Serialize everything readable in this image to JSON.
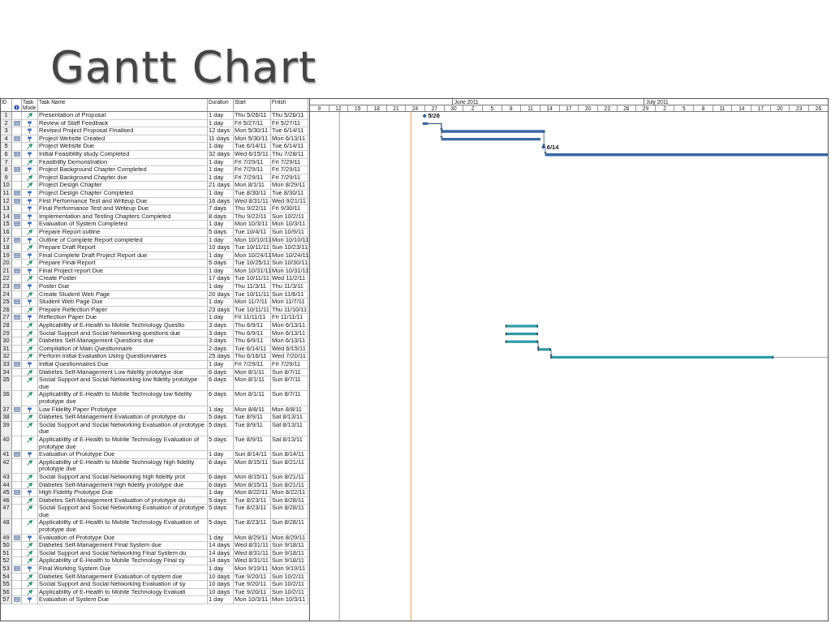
{
  "slide": {
    "title": "Gantt Chart"
  },
  "table": {
    "columns": [
      "ID",
      "Task Mode",
      "Task Name",
      "Duration",
      "Start",
      "Finish"
    ],
    "rows": [
      {
        "id": "1",
        "indicator": false,
        "kind": "auto",
        "name": "Presentation of Proposal",
        "duration": "1 day",
        "start": "Thu 5/26/11",
        "finish": "Thu 5/26/11"
      },
      {
        "id": "2",
        "indicator": true,
        "kind": "manual",
        "name": "Review of Staff Feedback",
        "duration": "1 day",
        "start": "Fri 5/27/11",
        "finish": "Fri 5/27/11"
      },
      {
        "id": "3",
        "indicator": false,
        "kind": "manual",
        "name": "Revised Project Proposal Finalised",
        "duration": "12 days",
        "start": "Mon 5/30/11",
        "finish": "Tue 6/14/11"
      },
      {
        "id": "4",
        "indicator": true,
        "kind": "manual",
        "name": "Project Website Created",
        "duration": "11 days",
        "start": "Mon 5/30/11",
        "finish": "Mon 6/13/11"
      },
      {
        "id": "5",
        "indicator": false,
        "kind": "auto",
        "name": "Project Website Due",
        "duration": "1 day",
        "start": "Tue 6/14/11",
        "finish": "Tue 6/14/11"
      },
      {
        "id": "6",
        "indicator": true,
        "kind": "manual",
        "name": "Initial Feasibility study Completed",
        "duration": "32 days",
        "start": "Wed 6/15/11",
        "finish": "Thu 7/28/11"
      },
      {
        "id": "7",
        "indicator": false,
        "kind": "auto",
        "name": "Feasibility Demonstration",
        "duration": "1 day",
        "start": "Fri 7/29/11",
        "finish": "Fri 7/29/11"
      },
      {
        "id": "8",
        "indicator": true,
        "kind": "manual",
        "name": "Project Background Chapter Completed",
        "duration": "1 day",
        "start": "Fri 7/29/11",
        "finish": "Fri 7/29/11"
      },
      {
        "id": "9",
        "indicator": false,
        "kind": "auto",
        "name": "Project Background Chapter due",
        "duration": "1 day",
        "start": "Fri 7/29/11",
        "finish": "Fri 7/29/11"
      },
      {
        "id": "10",
        "indicator": false,
        "kind": "auto",
        "name": "Project Design Chapter",
        "duration": "21 days",
        "start": "Mon 8/1/11",
        "finish": "Mon 8/29/11"
      },
      {
        "id": "11",
        "indicator": true,
        "kind": "manual",
        "name": "Project Design Chapter Completed",
        "duration": "1 day",
        "start": "Tue 8/30/11",
        "finish": "Tue 8/30/11"
      },
      {
        "id": "12",
        "indicator": true,
        "kind": "manual",
        "name": "First Performance Test and Writeup Due",
        "duration": "16 days",
        "start": "Wed 8/31/11",
        "finish": "Wed 9/21/11"
      },
      {
        "id": "13",
        "indicator": false,
        "kind": "manual",
        "name": "Final Performance Test and Writeup Due",
        "duration": "7 days",
        "start": "Thu 9/22/11",
        "finish": "Fri 9/30/11"
      },
      {
        "id": "14",
        "indicator": true,
        "kind": "manual",
        "name": "Implementation and Testing Chapters Completed",
        "duration": "8 days",
        "start": "Thu 9/22/11",
        "finish": "Sun 10/2/11"
      },
      {
        "id": "15",
        "indicator": true,
        "kind": "manual",
        "name": "Evaluation of System Completed",
        "duration": "1 day",
        "start": "Mon 10/3/11",
        "finish": "Mon 10/3/11"
      },
      {
        "id": "16",
        "indicator": false,
        "kind": "auto",
        "name": "Prepare Report outline",
        "duration": "5 days",
        "start": "Tue 10/4/11",
        "finish": "Sun 10/9/11"
      },
      {
        "id": "17",
        "indicator": true,
        "kind": "manual",
        "name": "Outline of Complete Report completed",
        "duration": "1 day",
        "start": "Mon 10/10/11",
        "finish": "Mon 10/10/11"
      },
      {
        "id": "18",
        "indicator": false,
        "kind": "auto",
        "name": "Prepare Draft Report",
        "duration": "10 days",
        "start": "Tue 10/11/11",
        "finish": "Sun 10/23/11"
      },
      {
        "id": "19",
        "indicator": true,
        "kind": "manual",
        "name": "Final Complete Draft Project Report due",
        "duration": "1 day",
        "start": "Mon 10/24/11",
        "finish": "Mon 10/24/11"
      },
      {
        "id": "20",
        "indicator": false,
        "kind": "auto",
        "name": "Prepare Final Report",
        "duration": "5 days",
        "start": "Tue 10/25/11",
        "finish": "Sun 10/30/11"
      },
      {
        "id": "21",
        "indicator": true,
        "kind": "manual",
        "name": "Final Project report Due",
        "duration": "1 day",
        "start": "Mon 10/31/11",
        "finish": "Mon 10/31/11"
      },
      {
        "id": "22",
        "indicator": false,
        "kind": "auto",
        "name": "Create Poster",
        "duration": "17 days",
        "start": "Tue 10/11/11",
        "finish": "Wed 11/2/11"
      },
      {
        "id": "23",
        "indicator": true,
        "kind": "manual",
        "name": "Poster Due",
        "duration": "1 day",
        "start": "Thu 11/3/11",
        "finish": "Thu 11/3/11"
      },
      {
        "id": "24",
        "indicator": false,
        "kind": "auto",
        "name": "Create Student Web Page",
        "duration": "20 days",
        "start": "Tue 10/11/11",
        "finish": "Sun 11/6/11"
      },
      {
        "id": "25",
        "indicator": true,
        "kind": "manual",
        "name": "Student Web Page Due",
        "duration": "1 day",
        "start": "Mon 11/7/11",
        "finish": "Mon 11/7/11"
      },
      {
        "id": "26",
        "indicator": false,
        "kind": "auto",
        "name": "Prepare Reflection Paper",
        "duration": "23 days",
        "start": "Tue 10/11/11",
        "finish": "Thu 11/10/11"
      },
      {
        "id": "27",
        "indicator": true,
        "kind": "manual",
        "name": "Reflection Paper Due",
        "duration": "1 day",
        "start": "Fri 11/11/11",
        "finish": "Fri 11/11/11"
      },
      {
        "id": "28",
        "indicator": false,
        "kind": "auto",
        "name": "Applicability of E-Health to Mobile Technology Questio",
        "duration": "3 days",
        "start": "Thu 6/9/11",
        "finish": "Mon 6/13/11"
      },
      {
        "id": "29",
        "indicator": false,
        "kind": "auto",
        "name": "Social Support and Social Networking questions due",
        "duration": "3 days",
        "start": "Thu 6/9/11",
        "finish": "Mon 6/13/11"
      },
      {
        "id": "30",
        "indicator": false,
        "kind": "auto",
        "name": "Diabetes Self-Management Questions due",
        "duration": "3 days",
        "start": "Thu 6/9/11",
        "finish": "Mon 6/13/11"
      },
      {
        "id": "31",
        "indicator": false,
        "kind": "auto",
        "name": "Compilation of Main Questionnaire",
        "duration": "2 days",
        "start": "Tue 6/14/11",
        "finish": "Wed 6/15/11"
      },
      {
        "id": "32",
        "indicator": false,
        "kind": "auto",
        "name": "Perform Initial Evaluation Using Questionnaires",
        "duration": "25 days",
        "start": "Thu 6/16/11",
        "finish": "Wed 7/20/11"
      },
      {
        "id": "33",
        "indicator": true,
        "kind": "manual",
        "name": "Initial Questionnaires Due",
        "duration": "1 day",
        "start": "Fri 7/29/11",
        "finish": "Fri 7/29/11"
      },
      {
        "id": "34",
        "indicator": false,
        "kind": "auto",
        "name": "Diabetes Self-Management Low fidelity prototype due",
        "duration": "6 days",
        "start": "Mon 8/1/11",
        "finish": "Sun 8/7/11"
      },
      {
        "id": "35",
        "indicator": false,
        "kind": "auto",
        "name": "Social Support and Social Networking low fidelity prototype due",
        "duration": "6 days",
        "start": "Mon 8/1/11",
        "finish": "Sun 8/7/11"
      },
      {
        "id": "36",
        "indicator": false,
        "kind": "auto",
        "name": "Applicability of E-Health to Mobile Technology low fidelity prototype due",
        "duration": "6 days",
        "start": "Mon 8/1/11",
        "finish": "Sun 8/7/11"
      },
      {
        "id": "37",
        "indicator": true,
        "kind": "manual",
        "name": "Low Fidelity Paper Prototype",
        "duration": "1 day",
        "start": "Mon 8/8/11",
        "finish": "Mon 8/8/11"
      },
      {
        "id": "38",
        "indicator": false,
        "kind": "auto",
        "name": "Diabetes Self-Management Evaluation of prototype du",
        "duration": "5 days",
        "start": "Tue 8/9/11",
        "finish": "Sat 8/13/11"
      },
      {
        "id": "39",
        "indicator": false,
        "kind": "auto",
        "name": "Social Support and Social Networking Evaluation of prototype due",
        "duration": "5 days",
        "start": "Tue 8/9/11",
        "finish": "Sat 8/13/11"
      },
      {
        "id": "40",
        "indicator": false,
        "kind": "auto",
        "name": "Applicability of E-Health to Mobile Technology Evaluation of prototype due",
        "duration": "5 days",
        "start": "Tue 8/9/11",
        "finish": "Sat 8/13/11"
      },
      {
        "id": "41",
        "indicator": true,
        "kind": "manual",
        "name": "Evaluation of Prototype Due",
        "duration": "1 day",
        "start": "Sun 8/14/11",
        "finish": "Sun 8/14/11"
      },
      {
        "id": "42",
        "indicator": false,
        "kind": "auto",
        "name": "Applicability of E-Health to Mobile Technology high fidelity prototype due",
        "duration": "6 days",
        "start": "Mon 8/15/11",
        "finish": "Sun 8/21/11"
      },
      {
        "id": "43",
        "indicator": false,
        "kind": "auto",
        "name": "Social Support and Social Networking high fidelity prot",
        "duration": "6 days",
        "start": "Mon 8/15/11",
        "finish": "Sun 8/21/11"
      },
      {
        "id": "44",
        "indicator": false,
        "kind": "auto",
        "name": "Diabetes Self-Management high fidelity prototype due",
        "duration": "6 days",
        "start": "Mon 8/15/11",
        "finish": "Sun 8/21/11"
      },
      {
        "id": "45",
        "indicator": true,
        "kind": "manual",
        "name": "High Fidelity Prototype Due",
        "duration": "1 day",
        "start": "Mon 8/22/11",
        "finish": "Mon 8/22/11"
      },
      {
        "id": "46",
        "indicator": false,
        "kind": "auto",
        "name": "Diabetes Self-Management Evaluation of prototype du",
        "duration": "5 days",
        "start": "Tue 8/23/11",
        "finish": "Sun 8/28/11"
      },
      {
        "id": "47",
        "indicator": false,
        "kind": "auto",
        "name": "Social Support and Social Networking Evaluation of prototype due",
        "duration": "5 days",
        "start": "Tue 8/23/11",
        "finish": "Sun 8/28/11"
      },
      {
        "id": "48",
        "indicator": false,
        "kind": "auto",
        "name": "Applicability of E-Health to Mobile Technology Evaluation of prototype due",
        "duration": "5 days",
        "start": "Tue 8/23/11",
        "finish": "Sun 8/28/11"
      },
      {
        "id": "49",
        "indicator": true,
        "kind": "manual",
        "name": "Evaluation of Prototype Due",
        "duration": "1 day",
        "start": "Mon 8/29/11",
        "finish": "Mon 8/29/11"
      },
      {
        "id": "50",
        "indicator": false,
        "kind": "auto",
        "name": "Diabetes Self-Management Final System due",
        "duration": "14 days",
        "start": "Wed 8/31/11",
        "finish": "Sun 9/18/11"
      },
      {
        "id": "51",
        "indicator": false,
        "kind": "auto",
        "name": "Social Support and Social Networking Final System du",
        "duration": "14 days",
        "start": "Wed 8/31/11",
        "finish": "Sun 9/18/11"
      },
      {
        "id": "52",
        "indicator": false,
        "kind": "auto",
        "name": "Applicability of E-Health to Mobile Technology Final sy",
        "duration": "14 days",
        "start": "Wed 8/31/11",
        "finish": "Sun 9/18/11"
      },
      {
        "id": "53",
        "indicator": true,
        "kind": "manual",
        "name": "Final Working System Due",
        "duration": "1 day",
        "start": "Mon 9/19/11",
        "finish": "Mon 9/19/11"
      },
      {
        "id": "54",
        "indicator": false,
        "kind": "auto",
        "name": "Diabetes Self-Management Evaluation of system due",
        "duration": "10 days",
        "start": "Tue 9/20/11",
        "finish": "Sun 10/2/11"
      },
      {
        "id": "55",
        "indicator": false,
        "kind": "auto",
        "name": "Social Support and Social Networking Evaluation of sy",
        "duration": "10 days",
        "start": "Tue 9/20/11",
        "finish": "Sun 10/2/11"
      },
      {
        "id": "56",
        "indicator": false,
        "kind": "auto",
        "name": "Applicability of E-Health to Mobile Technology Evaluati",
        "duration": "10 days",
        "start": "Tue 9/20/11",
        "finish": "Sun 10/2/11"
      },
      {
        "id": "57",
        "indicator": true,
        "kind": "manual",
        "name": "Evaluation of System Due",
        "duration": "1 day",
        "start": "Mon 10/3/11",
        "finish": "Mon 10/3/11"
      }
    ]
  },
  "timeline": {
    "months": [
      "June 2011",
      "July 2011"
    ],
    "days": [
      "9",
      "12",
      "15",
      "18",
      "21",
      "24",
      "27",
      "30",
      "2",
      "5",
      "8",
      "11",
      "14",
      "17",
      "20",
      "23",
      "26",
      "29",
      "2",
      "5",
      "8",
      "11",
      "14",
      "17",
      "20",
      "23",
      "26"
    ],
    "milestones": [
      "5/26",
      "6/14"
    ]
  }
}
